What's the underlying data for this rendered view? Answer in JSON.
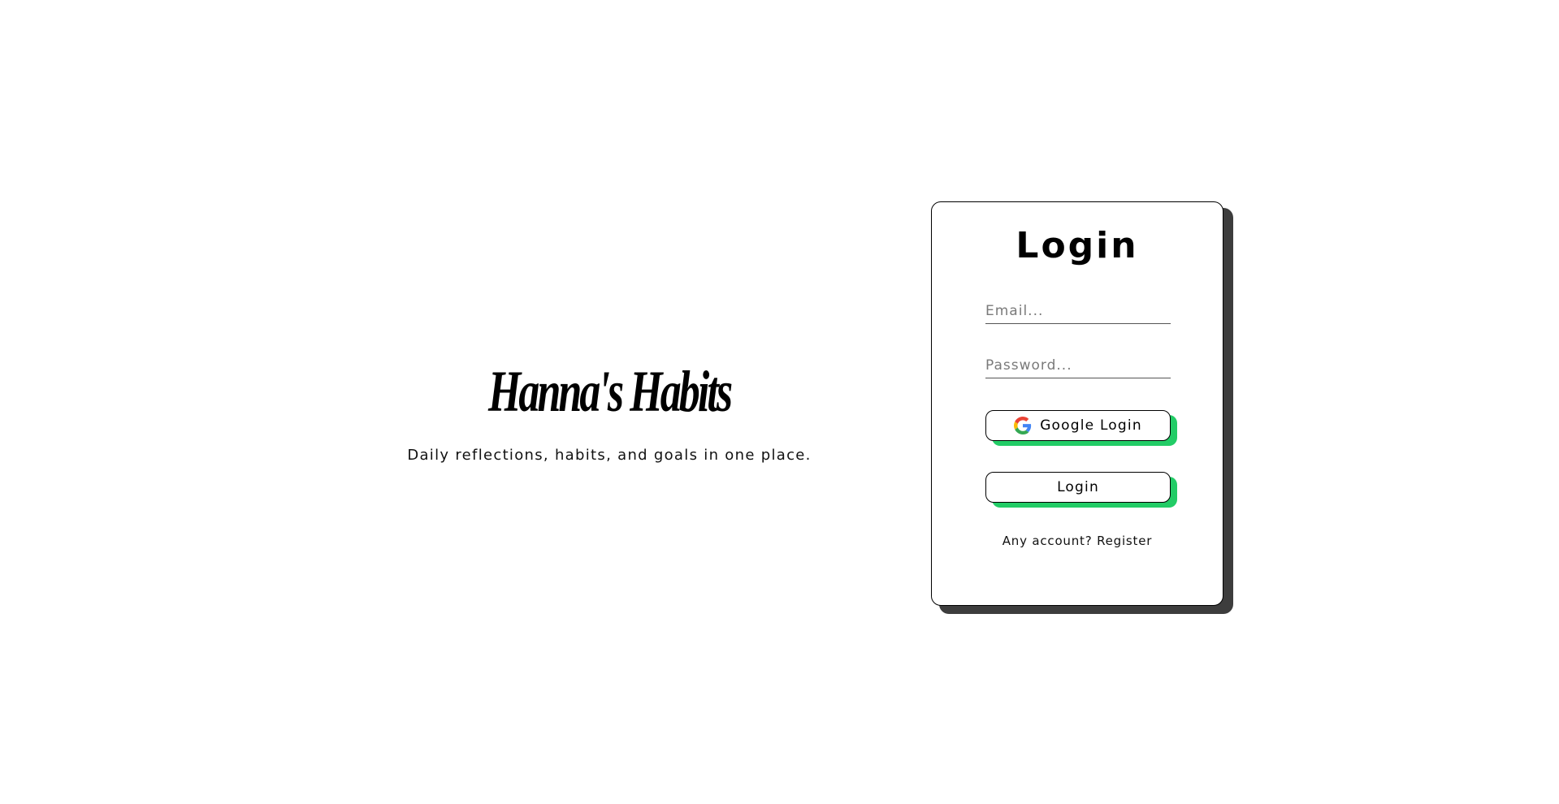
{
  "brand": {
    "title": "Hanna's Habits",
    "tagline": "Daily reflections, habits, and goals in one place."
  },
  "login_card": {
    "title": "Login",
    "email_placeholder": "Email...",
    "password_placeholder": "Password...",
    "google_button_label": "Google Login",
    "login_button_label": "Login",
    "register_prompt": "Any account?",
    "register_link": "Register"
  },
  "colors": {
    "accent_shadow": "#22cc66",
    "card_shadow": "#3d3d3d"
  },
  "icons": {
    "google": "google-g-icon"
  }
}
